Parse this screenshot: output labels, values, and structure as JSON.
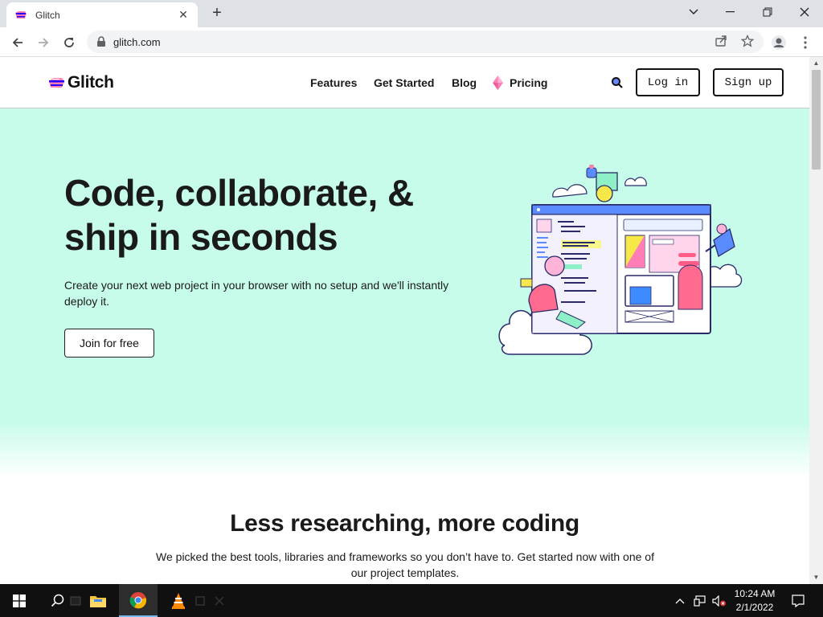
{
  "browser": {
    "tab_title": "Glitch",
    "url": "glitch.com"
  },
  "site": {
    "logo_text": "Glitch",
    "nav": [
      "Features",
      "Get Started",
      "Blog",
      "Pricing"
    ],
    "login_label": "Log in",
    "signup_label": "Sign up"
  },
  "hero": {
    "title_line1": "Code, collaborate, &",
    "title_line2": "ship in seconds",
    "subtitle": "Create your next web project in your browser with no setup and we'll instantly deploy it.",
    "cta_label": "Join for free"
  },
  "section": {
    "title": "Less researching, more coding",
    "subtitle": "We picked the best tools, libraries and frameworks so you don’t have to. Get started now with one of our project templates."
  },
  "taskbar": {
    "time": "10:24 AM",
    "date": "2/1/2022"
  },
  "colors": {
    "hero_bg": "#c7fcea",
    "glitch_pink": "#ff7eb6",
    "glitch_blue": "#2800ff"
  }
}
